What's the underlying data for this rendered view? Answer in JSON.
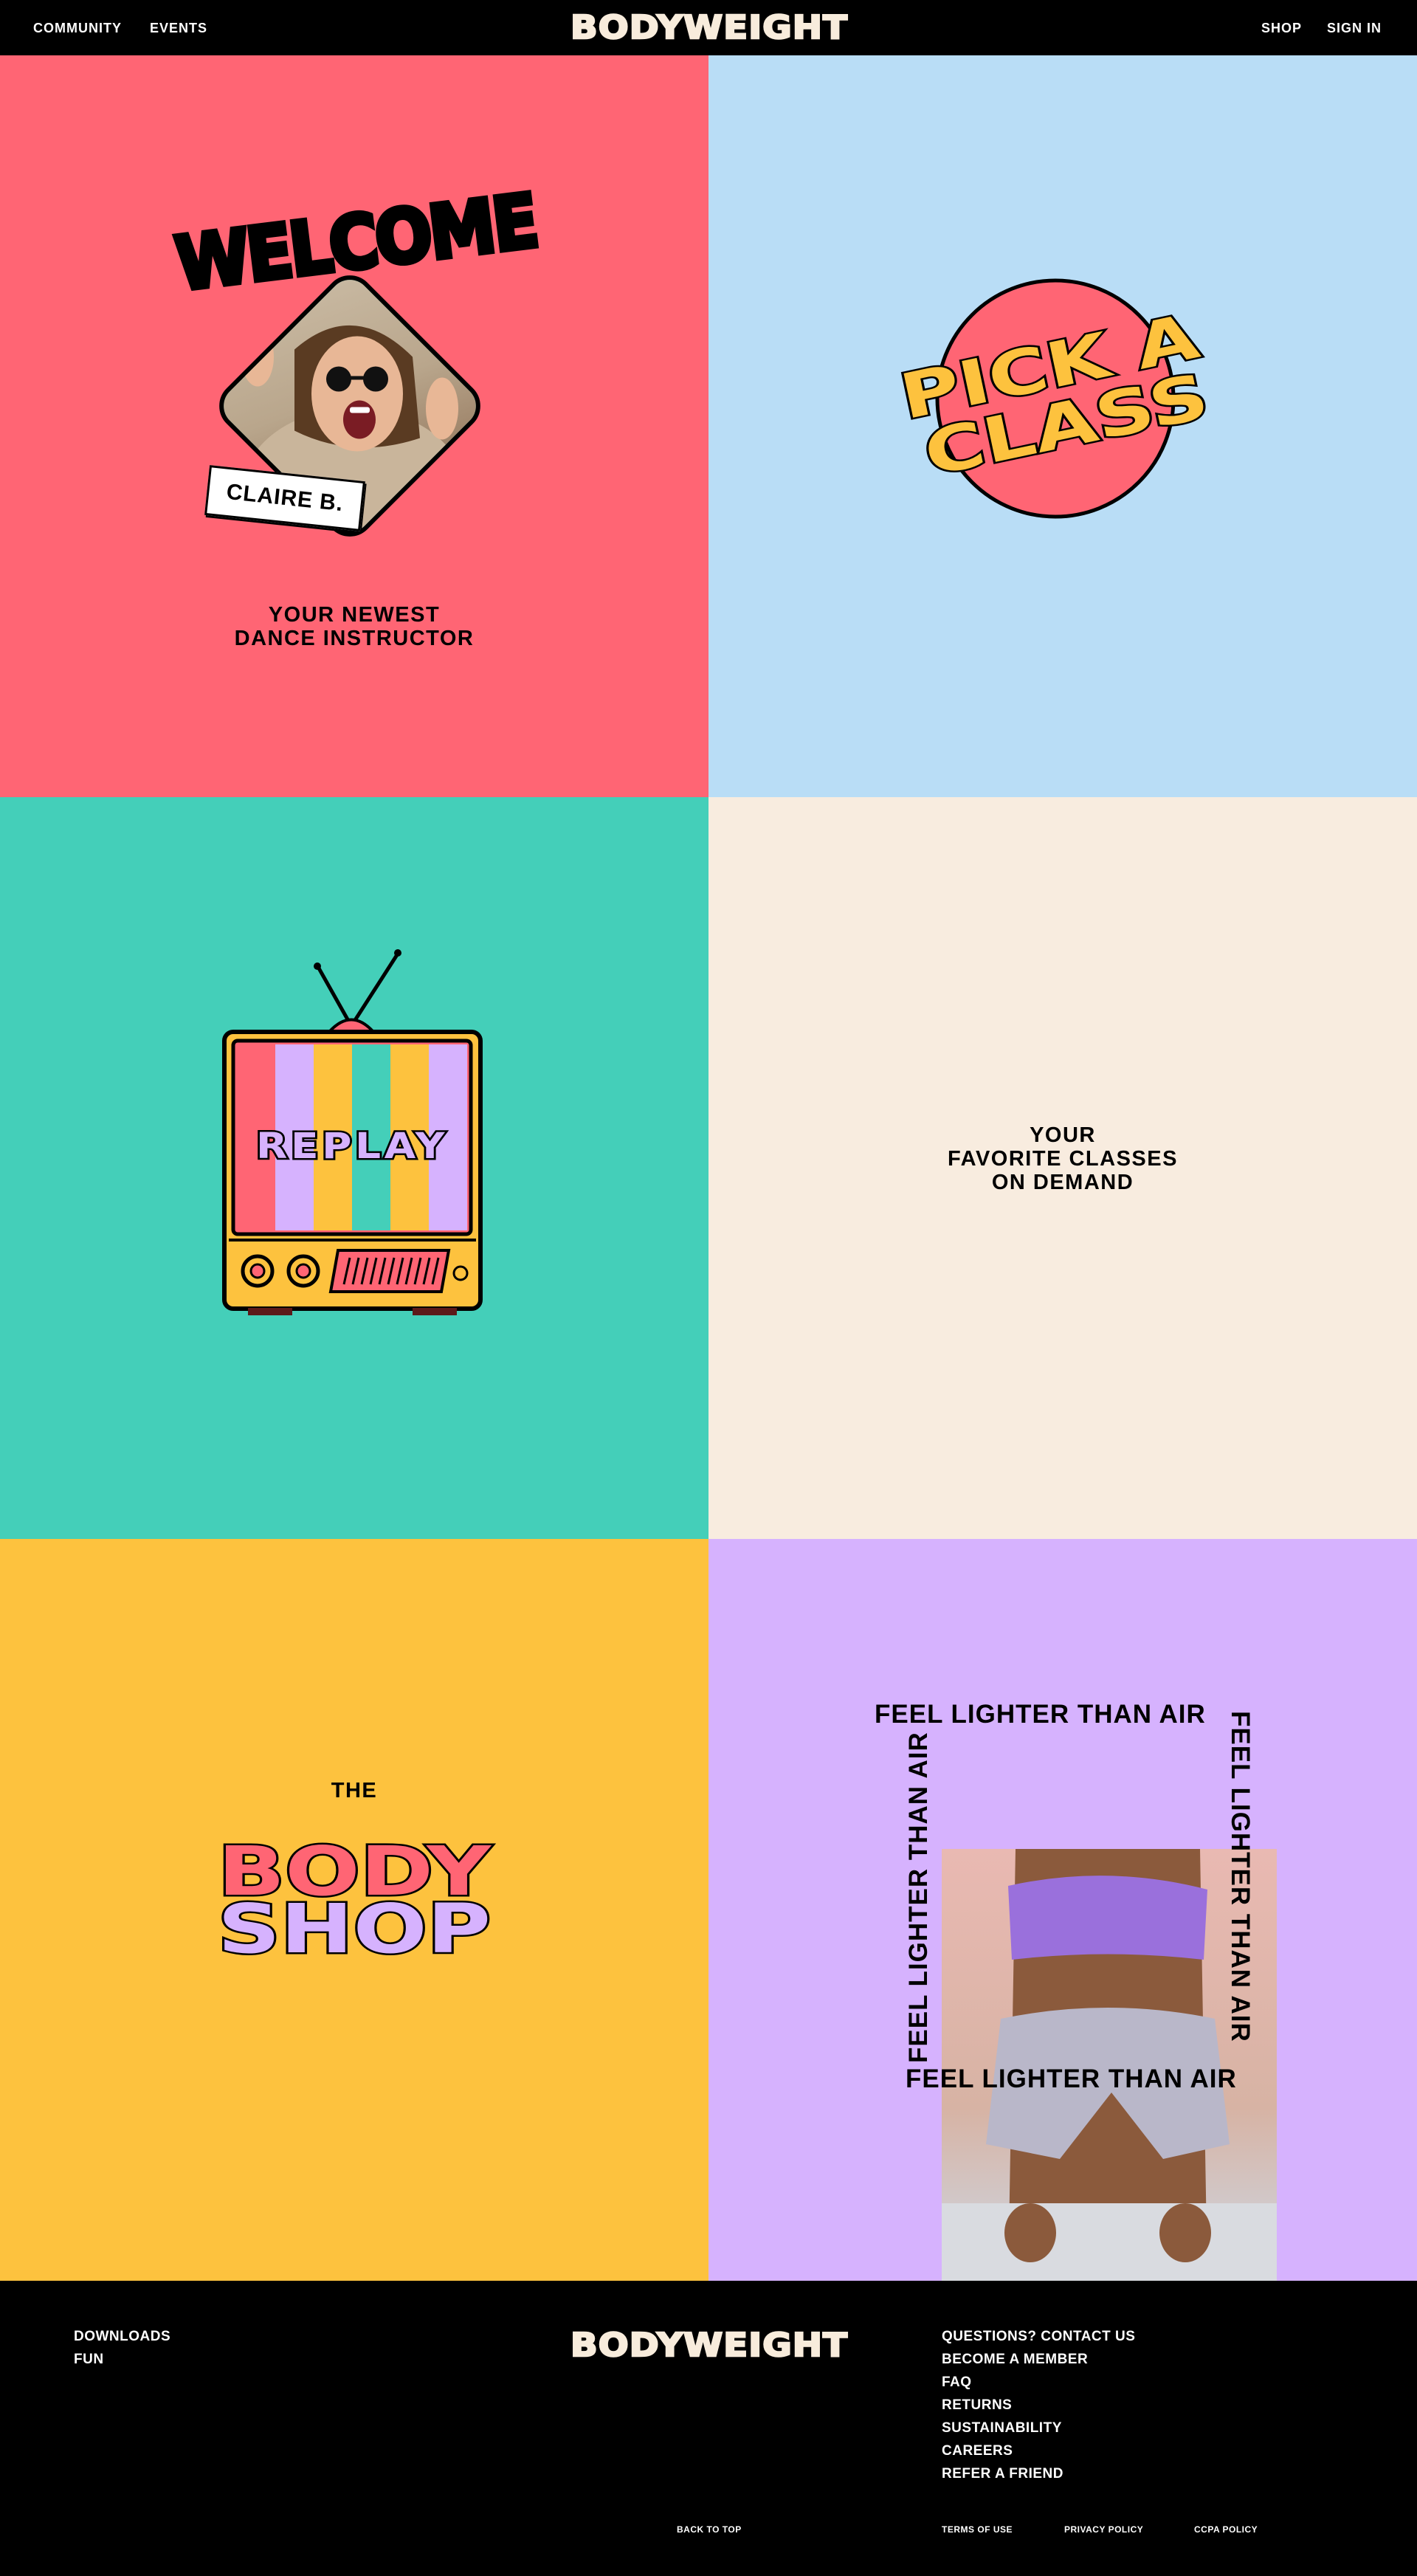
{
  "header": {
    "nav_left": [
      "COMMUNITY",
      "EVENTS"
    ],
    "nav_right": [
      "SHOP",
      "SIGN IN"
    ],
    "logo": "BODYWEIGHT"
  },
  "welcome": {
    "title": "WELCOME",
    "name_tag": "CLAIRE B.",
    "caption_line1": "YOUR NEWEST",
    "caption_line2": "DANCE INSTRUCTOR"
  },
  "pick": {
    "line1": "PICK A",
    "line2": "CLASS"
  },
  "replay": {
    "label": "REPLAY"
  },
  "demand": {
    "line1": "YOUR",
    "line2": "FAVORITE CLASSES",
    "line3": "ON DEMAND"
  },
  "shop": {
    "the": "THE",
    "word1": "BODY",
    "word2": "SHOP"
  },
  "feel": {
    "text": "FEEL LIGHTER THAN AIR"
  },
  "footer": {
    "left_links": [
      "DOWNLOADS",
      "FUN"
    ],
    "logo": "BODYWEIGHT",
    "right_links": [
      "QUESTIONS? CONTACT US",
      "BECOME A MEMBER",
      "FAQ",
      "RETURNS",
      "SUSTAINABILITY",
      "CAREERS",
      "REFER A FRIEND"
    ],
    "back_to_top": "BACK TO TOP",
    "legal": [
      "TERMS OF USE",
      "PRIVACY POLICY",
      "CCPA POLICY"
    ]
  },
  "colors": {
    "coral": "#ff6574",
    "sky": "#b9ddf6",
    "teal": "#44cfb9",
    "cream": "#f8ecdf",
    "mustard": "#fdc23e",
    "lavender": "#d6b2fe",
    "black": "#000000"
  }
}
